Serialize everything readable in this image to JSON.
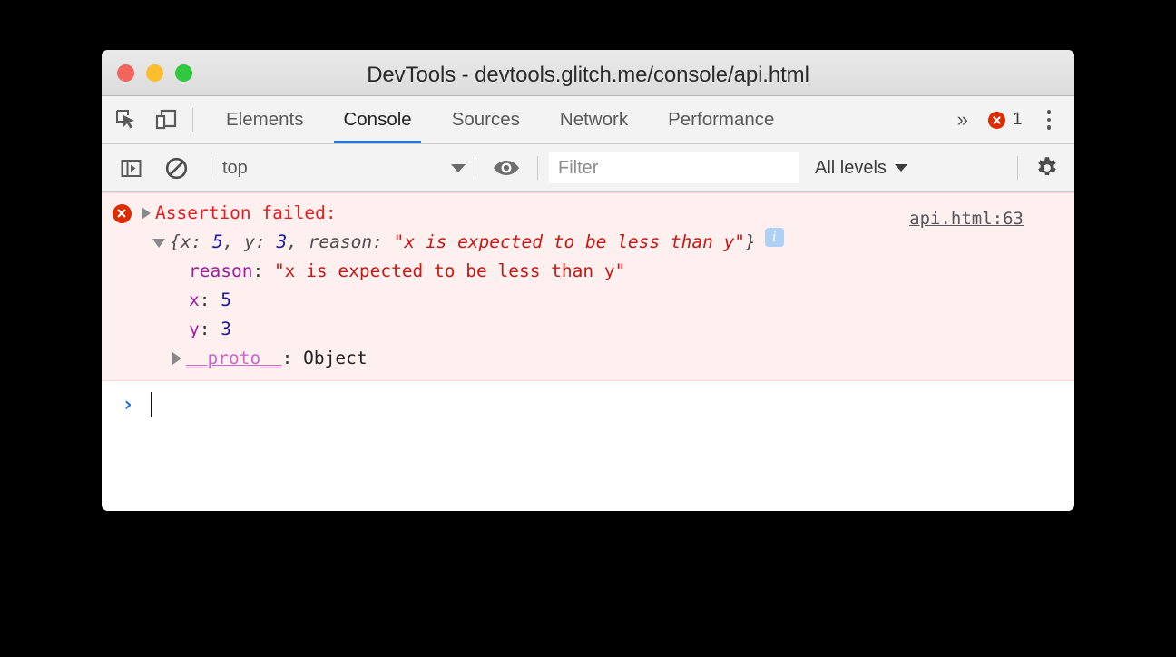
{
  "window": {
    "title": "DevTools - devtools.glitch.me/console/api.html",
    "traffic_lights": [
      "close-button",
      "minimize-button",
      "zoom-button"
    ]
  },
  "tabbar": {
    "inspect_icon": "inspect-element-icon",
    "device_icon": "device-toolbar-icon",
    "tabs": [
      {
        "label": "Elements",
        "active": false
      },
      {
        "label": "Console",
        "active": true
      },
      {
        "label": "Sources",
        "active": false
      },
      {
        "label": "Network",
        "active": false
      },
      {
        "label": "Performance",
        "active": false
      }
    ],
    "overflow_label": "»",
    "error_count": "1",
    "error_icon": "error-circle-icon",
    "menu_icon": "kebab-menu-icon"
  },
  "console_toolbar": {
    "sidebar_icon": "console-sidebar-icon",
    "clear_icon": "clear-console-icon",
    "context": "top",
    "eye_icon": "live-expression-eye-icon",
    "filter_placeholder": "Filter",
    "filter_value": "",
    "levels_label": "All levels",
    "settings_icon": "gear-icon"
  },
  "console": {
    "messages": [
      {
        "type": "error",
        "assert_text": "Assertion failed:",
        "source_link": "api.html:63",
        "preview": {
          "open_brace": "{",
          "parts": [
            {
              "key": "x",
              "sep": ": ",
              "value": "5",
              "kind": "number"
            },
            {
              "key": "y",
              "sep": ": ",
              "value": "3",
              "kind": "number"
            },
            {
              "key": "reason",
              "sep": ": ",
              "value": "\"x is expected to be less than y\"",
              "kind": "string"
            }
          ],
          "close_brace": "}",
          "info_badge": "i"
        },
        "properties": [
          {
            "key": "reason",
            "value": "\"x is expected to be less than y\"",
            "kind": "string"
          },
          {
            "key": "x",
            "value": "5",
            "kind": "number"
          },
          {
            "key": "y",
            "value": "3",
            "kind": "number"
          }
        ],
        "proto": {
          "key": "__proto__",
          "value": "Object"
        }
      }
    ],
    "prompt_arrow": "›",
    "prompt_value": ""
  },
  "colors": {
    "accent": "#1a73e8",
    "error": "#dd2c00",
    "error_text": "#e02020",
    "error_bg": "#fff0f0",
    "string": "#c41a16",
    "number": "#1a1aa6",
    "key": "#9b1fa0",
    "proto": "#cc66cc"
  }
}
